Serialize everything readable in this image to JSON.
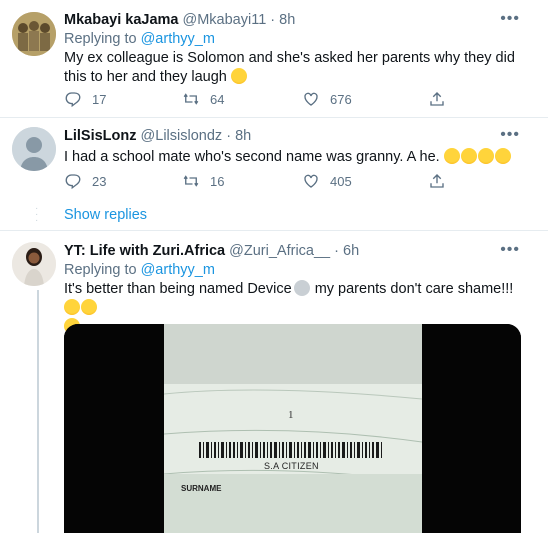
{
  "tweets": [
    {
      "name": "Mkabayi kaJama",
      "handle": "@Mkabayi11",
      "time": "8h",
      "replying_prefix": "Replying to",
      "replying_to": "@arthyy_m",
      "text": "My ex colleague is Solomon and she's asked her parents why they did this to her and they laugh",
      "replies": "17",
      "retweets": "64",
      "likes": "676"
    },
    {
      "name": "LilSisLonz",
      "handle": "@Lilsislondz",
      "time": "8h",
      "text": "I had a school mate who's second name was granny. A he.",
      "replies": "23",
      "retweets": "16",
      "likes": "405"
    },
    {
      "name": "YT: Life with Zuri.Africa",
      "handle": "@Zuri_Africa__",
      "time": "6h",
      "replying_prefix": "Replying to",
      "replying_to": "@arthyy_m",
      "text": "It's better than being named Device",
      "text2": "my parents don't care shame!!!"
    }
  ],
  "show_replies": "Show replies",
  "media": {
    "page_number": "1",
    "barcode_label": "S.A CITIZEN",
    "field_label": "SURNAME"
  },
  "colors": {
    "link": "#1b95e0",
    "muted": "#5b7083",
    "divider": "#e6ecf0"
  },
  "icons": [
    "reply-icon",
    "retweet-icon",
    "like-icon",
    "share-icon",
    "more-icon"
  ]
}
